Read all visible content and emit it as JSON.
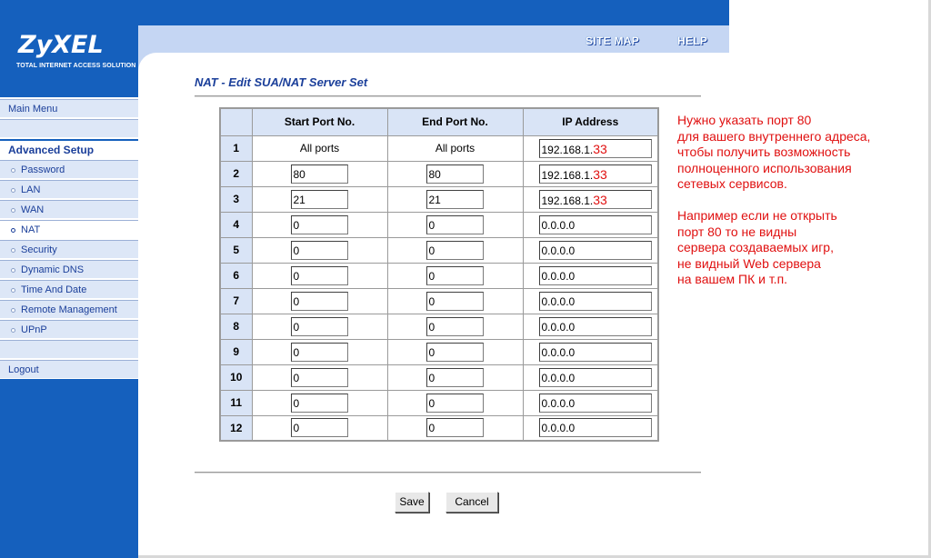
{
  "logo": {
    "brand": "ZyXEL",
    "tagline": "TOTAL INTERNET ACCESS SOLUTION"
  },
  "topnav": {
    "site_map": "SITE MAP",
    "help": "HELP"
  },
  "sidebar": {
    "main_menu": "Main Menu",
    "advanced_setup": "Advanced Setup",
    "items": [
      {
        "label": "Password"
      },
      {
        "label": "LAN"
      },
      {
        "label": "WAN"
      },
      {
        "label": "NAT"
      },
      {
        "label": "Security"
      },
      {
        "label": "Dynamic DNS"
      },
      {
        "label": "Time And Date"
      },
      {
        "label": "Remote Management"
      },
      {
        "label": "UPnP"
      }
    ],
    "logout": "Logout",
    "active_item": "NAT"
  },
  "page": {
    "title": "NAT - Edit SUA/NAT Server Set"
  },
  "table": {
    "headers": {
      "num": "",
      "start": "Start Port No.",
      "end": "End Port No.",
      "ip": "IP Address"
    },
    "rows": [
      {
        "num": "1",
        "start": "All ports",
        "end": "All ports",
        "ip_prefix": "192.168.1.",
        "ip_suffix": "33"
      },
      {
        "num": "2",
        "start": "80",
        "end": "80",
        "ip_prefix": "192.168.1.",
        "ip_suffix": "33"
      },
      {
        "num": "3",
        "start": "21",
        "end": "21",
        "ip_prefix": "192.168.1.",
        "ip_suffix": "33"
      },
      {
        "num": "4",
        "start": "0",
        "end": "0",
        "ip_prefix": "0.0.0.0",
        "ip_suffix": ""
      },
      {
        "num": "5",
        "start": "0",
        "end": "0",
        "ip_prefix": "0.0.0.0",
        "ip_suffix": ""
      },
      {
        "num": "6",
        "start": "0",
        "end": "0",
        "ip_prefix": "0.0.0.0",
        "ip_suffix": ""
      },
      {
        "num": "7",
        "start": "0",
        "end": "0",
        "ip_prefix": "0.0.0.0",
        "ip_suffix": ""
      },
      {
        "num": "8",
        "start": "0",
        "end": "0",
        "ip_prefix": "0.0.0.0",
        "ip_suffix": ""
      },
      {
        "num": "9",
        "start": "0",
        "end": "0",
        "ip_prefix": "0.0.0.0",
        "ip_suffix": ""
      },
      {
        "num": "10",
        "start": "0",
        "end": "0",
        "ip_prefix": "0.0.0.0",
        "ip_suffix": ""
      },
      {
        "num": "11",
        "start": "0",
        "end": "0",
        "ip_prefix": "0.0.0.0",
        "ip_suffix": ""
      },
      {
        "num": "12",
        "start": "0",
        "end": "0",
        "ip_prefix": "0.0.0.0",
        "ip_suffix": ""
      }
    ]
  },
  "buttons": {
    "save": "Save",
    "cancel": "Cancel"
  },
  "note": {
    "lines": [
      "Нужно указать порт 80",
      "для вашего внутреннего адреса,",
      "чтобы получить возможность",
      "полноценного использования",
      "сетевых сервисов.",
      "",
      "Например если не открыть",
      "порт 80 то не видны",
      "сервера создаваемых игр,",
      "не видный Web сервера",
      "на вашем ПК и т.п."
    ]
  },
  "colors": {
    "brand_blue": "#1560bd",
    "nav_light": "#c5d6f3",
    "menu_bg": "#dde7f7",
    "title_blue": "#1b3f9a",
    "annotation_red": "#e01010"
  }
}
